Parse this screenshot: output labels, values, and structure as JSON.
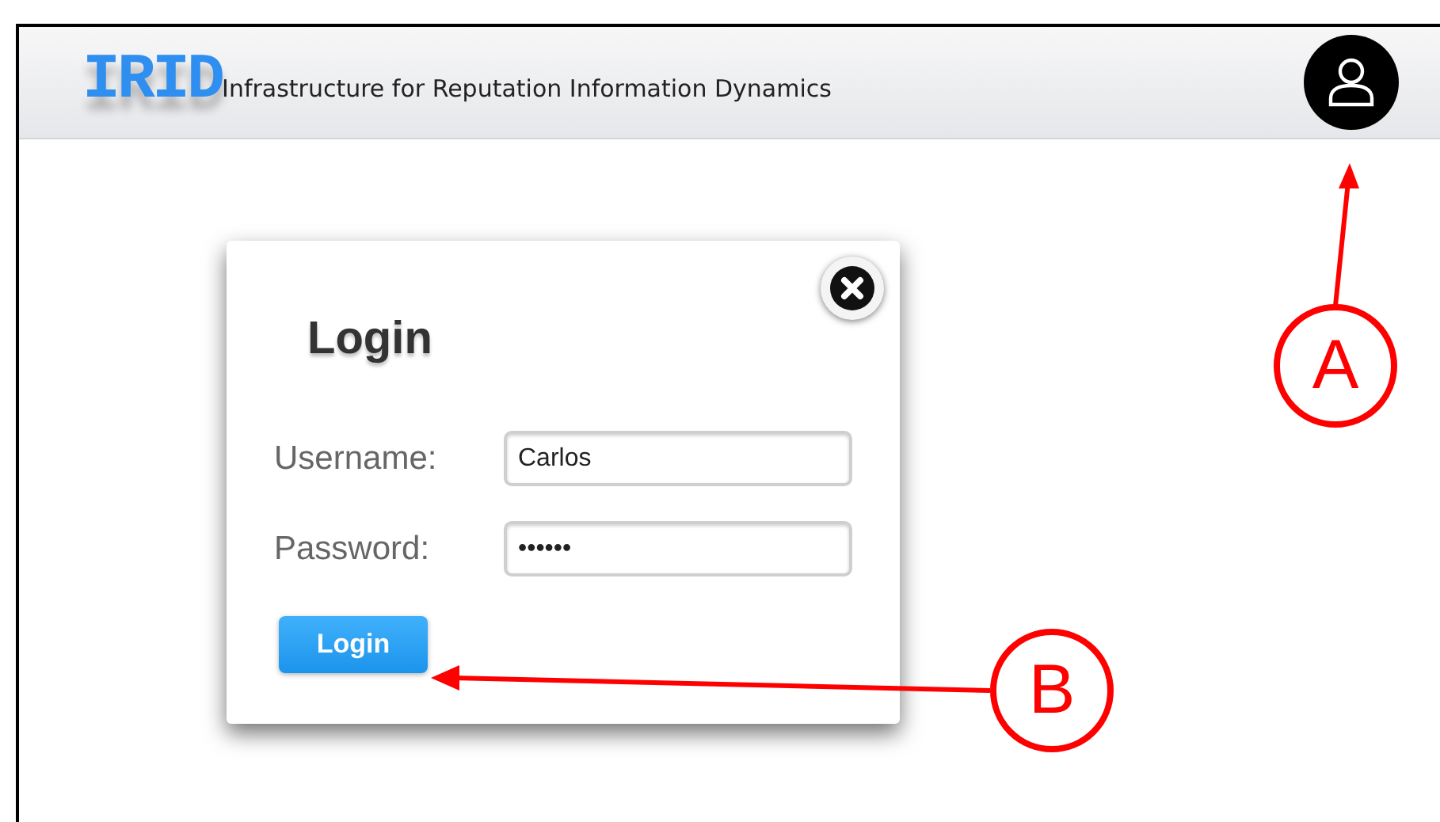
{
  "header": {
    "logo": "IRID",
    "subtitle": "Infrastructure for Reputation Information Dynamics"
  },
  "dialog": {
    "title": "Login",
    "fields": [
      {
        "label": "Username:",
        "value": "Carlos"
      },
      {
        "label": "Password:",
        "value": "••••••"
      }
    ],
    "button": "Login"
  },
  "annotations": [
    {
      "label": "A"
    },
    {
      "label": "B"
    }
  ]
}
